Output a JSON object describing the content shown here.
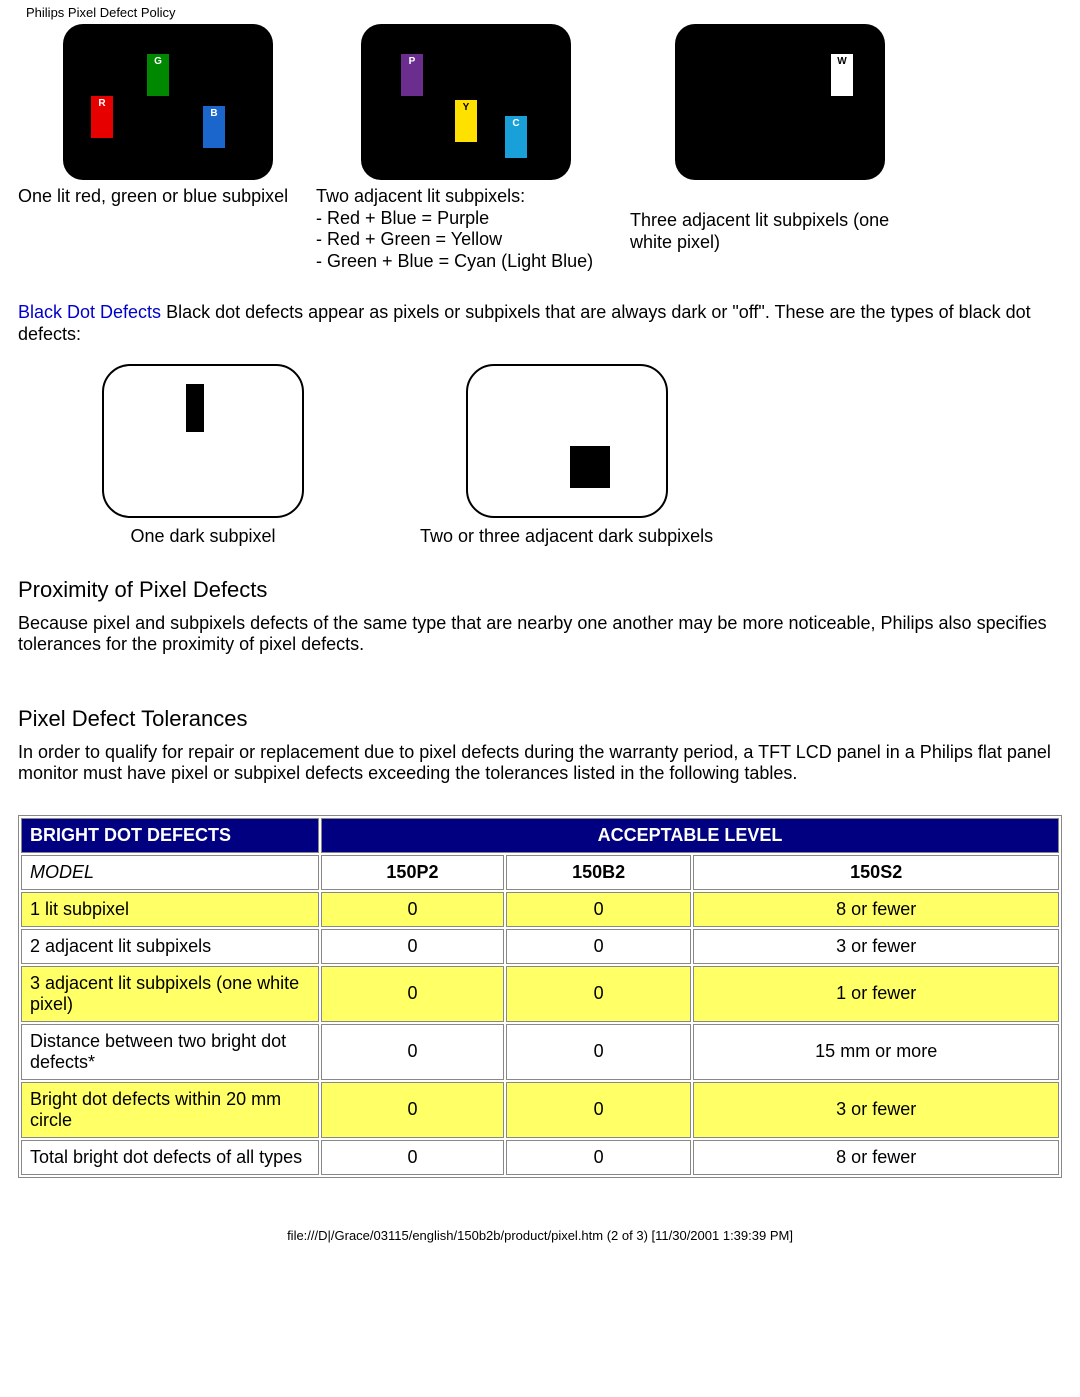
{
  "header": "Philips Pixel Defect Policy",
  "lit": {
    "cols": [
      {
        "subpixels": [
          {
            "cls": "red",
            "label": "R"
          },
          {
            "cls": "green",
            "label": "G"
          },
          {
            "cls": "blue",
            "label": "B"
          }
        ],
        "caption": "One lit red, green or blue subpixel"
      },
      {
        "subpixels": [
          {
            "cls": "purple",
            "label": "P"
          },
          {
            "cls": "yellow",
            "label": "Y"
          },
          {
            "cls": "cyan",
            "label": "C"
          }
        ],
        "caption": "Two adjacent lit subpixels:\n- Red + Blue = Purple\n- Red + Green = Yellow\n- Green + Blue = Cyan (Light Blue)"
      },
      {
        "subpixels": [
          {
            "cls": "white",
            "label": "W"
          }
        ],
        "caption": "Three adjacent lit subpixels (one white pixel)"
      }
    ]
  },
  "black_dot": {
    "heading": "Black Dot Defects",
    "text": " Black dot defects appear as pixels or subpixels that are always dark or \"off\". These are the types of black dot defects:",
    "captions": [
      "One dark subpixel",
      "Two or three adjacent dark subpixels"
    ]
  },
  "proximity": {
    "heading": "Proximity of Pixel Defects",
    "text": "Because pixel and subpixels defects of the same type that are nearby one another may be more noticeable, Philips also specifies tolerances for the proximity of pixel defects."
  },
  "tolerances": {
    "heading": "Pixel Defect Tolerances",
    "text": "In order to qualify for repair or replacement due to pixel defects during the warranty period, a TFT LCD panel in a Philips flat panel monitor must have pixel or subpixel defects exceeding the tolerances listed in the following tables."
  },
  "table": {
    "header_left": "BRIGHT DOT DEFECTS",
    "header_right": "ACCEPTABLE LEVEL",
    "model_label": "MODEL",
    "models": [
      "150P2",
      "150B2",
      "150S2"
    ],
    "rows": [
      {
        "label": "1 lit subpixel",
        "vals": [
          "0",
          "0",
          "8 or fewer"
        ],
        "hl": true
      },
      {
        "label": "2 adjacent lit subpixels",
        "vals": [
          "0",
          "0",
          "3 or fewer"
        ],
        "hl": false
      },
      {
        "label": "3 adjacent lit subpixels (one white pixel)",
        "vals": [
          "0",
          "0",
          "1 or fewer"
        ],
        "hl": true
      },
      {
        "label": "Distance between two bright dot defects*",
        "vals": [
          "0",
          "0",
          "15 mm or more"
        ],
        "hl": false
      },
      {
        "label": "Bright dot defects within 20 mm circle",
        "vals": [
          "0",
          "0",
          "3 or fewer"
        ],
        "hl": true
      },
      {
        "label": "Total bright dot defects of all types",
        "vals": [
          "0",
          "0",
          "8 or fewer"
        ],
        "hl": false
      }
    ]
  },
  "footer": "file:///D|/Grace/03115/english/150b2b/product/pixel.htm (2 of 3) [11/30/2001 1:39:39 PM]"
}
